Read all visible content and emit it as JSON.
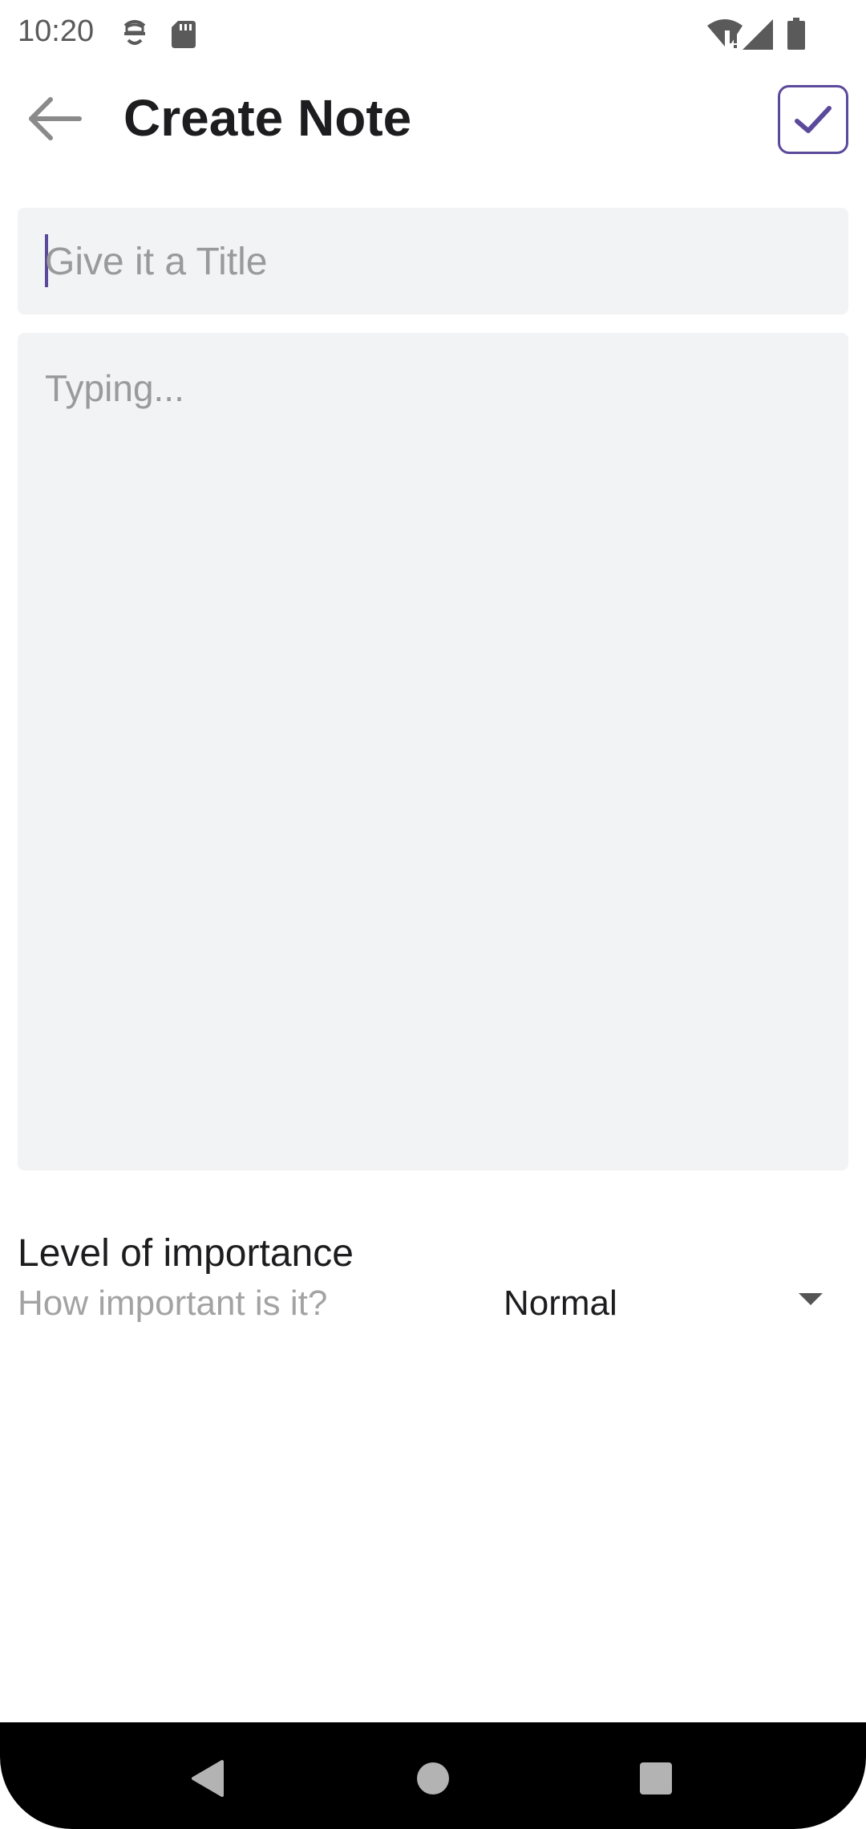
{
  "status_bar": {
    "time": "10:20",
    "icons": [
      "sync-icon",
      "sd-card-icon",
      "wifi-alert-icon",
      "signal-icon",
      "battery-icon"
    ]
  },
  "app_bar": {
    "title": "Create Note",
    "back_icon": "arrow-left-icon",
    "save_icon": "check-icon"
  },
  "form": {
    "title_placeholder": "Give it a Title",
    "title_value": "",
    "body_placeholder": "Typing...",
    "body_value": ""
  },
  "importance": {
    "label": "Level of importance",
    "sublabel": "How important is it?",
    "selected": "Normal"
  },
  "navigation": {
    "back": "nav-back-icon",
    "home": "nav-home-icon",
    "recents": "nav-recents-icon"
  },
  "colors": {
    "accent": "#5b4a9b",
    "field_background": "#f2f3f5",
    "placeholder": "#9a9a9a"
  }
}
